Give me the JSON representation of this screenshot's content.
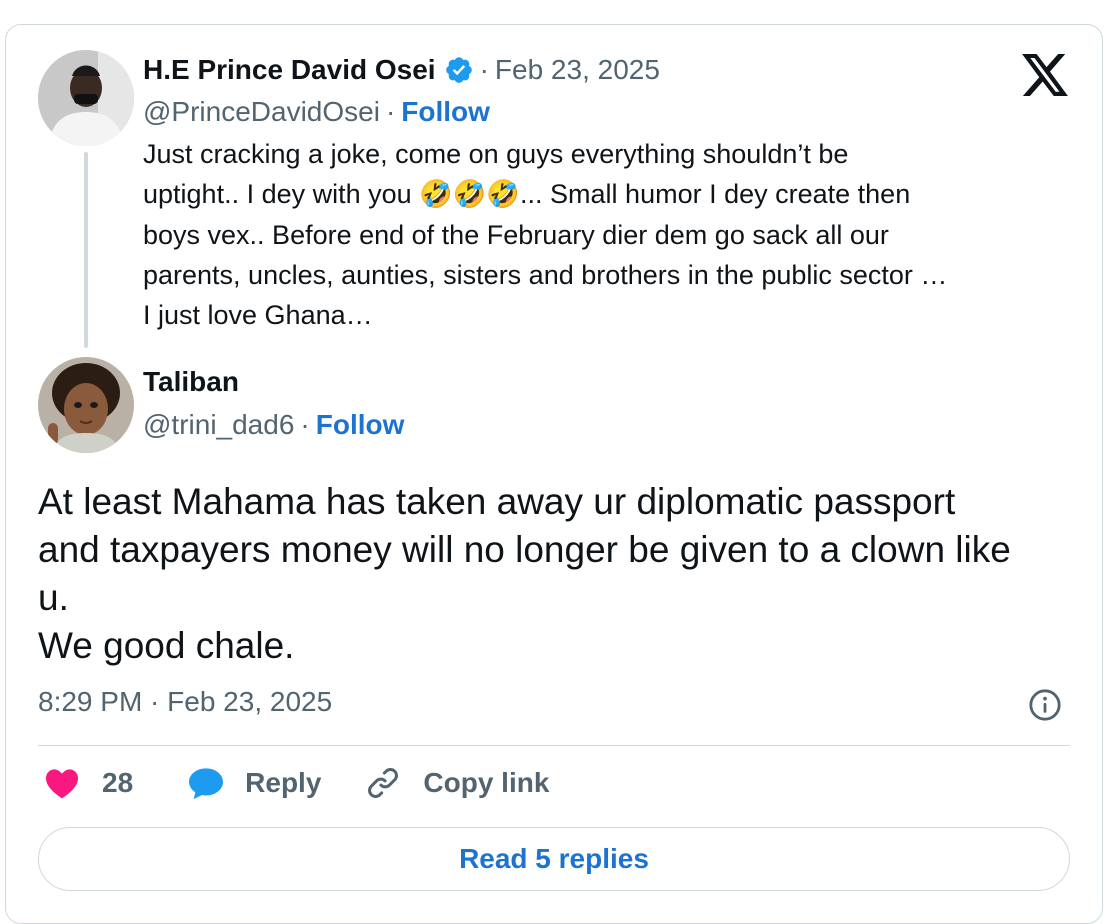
{
  "quoted_tweet": {
    "author_name": "H.E Prince David Osei",
    "handle": "@PrinceDavidOsei",
    "date": "Feb 23, 2025",
    "follow_label": "Follow",
    "verified_icon": "verified-badge-icon",
    "text_lines": [
      "Just cracking a joke,  come on guys everything shouldn’t be",
      "uptight.. I dey with you",
      "🤣🤣🤣",
      "... Small humor I dey create then",
      "boys vex.. Before  end of the February dier dem go sack all our",
      "parents, uncles, aunties, sisters and brothers in the public sector …",
      "I just love Ghana…"
    ]
  },
  "reply_tweet": {
    "author_name": "Taliban",
    "handle": "@trini_dad6",
    "follow_label": "Follow",
    "text_lines": [
      "At least Mahama has taken away ur diplomatic passport",
      "and taxpayers money will no longer be given to a clown like",
      "u.",
      "We good chale."
    ],
    "timestamp": "8:29 PM · Feb 23, 2025"
  },
  "actions": {
    "like_count": "28",
    "reply_label": "Reply",
    "copy_link_label": "Copy link",
    "read_replies_label": "Read 5 replies"
  },
  "separator": "·",
  "colors": {
    "accent": "#1d74d0",
    "like": "#f91880",
    "reply_bubble": "#1d9bf0",
    "verified": "#1d9bf0",
    "muted_text": "#536471",
    "border": "#cfd9de"
  },
  "icons": [
    "x-logo-icon",
    "verified-badge-icon",
    "heart-icon",
    "reply-bubble-icon",
    "link-icon",
    "info-icon"
  ]
}
